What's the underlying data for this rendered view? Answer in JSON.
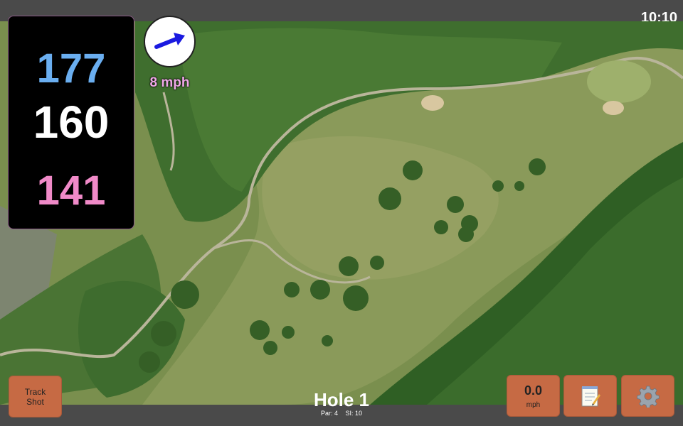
{
  "status_bar": {
    "time": "10:10"
  },
  "distances": {
    "back": "177",
    "middle": "160",
    "front": "141"
  },
  "wind": {
    "speed_label": "8 mph",
    "direction_icon": "arrow-icon"
  },
  "track_shot": {
    "label": "Track Shot"
  },
  "wind_button": {
    "value": "0.0",
    "unit": "mph"
  },
  "hole": {
    "title": "Hole 1",
    "par": "Par: 4",
    "si": "SI: 10"
  },
  "icons": {
    "notes": "notepad-icon",
    "settings": "gear-icon"
  },
  "colors": {
    "back_distance": "#6aaef0",
    "middle_distance": "#ffffff",
    "front_distance": "#f08ac8",
    "button_bg": "#c66a44",
    "wind_arrow": "#1a1ae0"
  }
}
